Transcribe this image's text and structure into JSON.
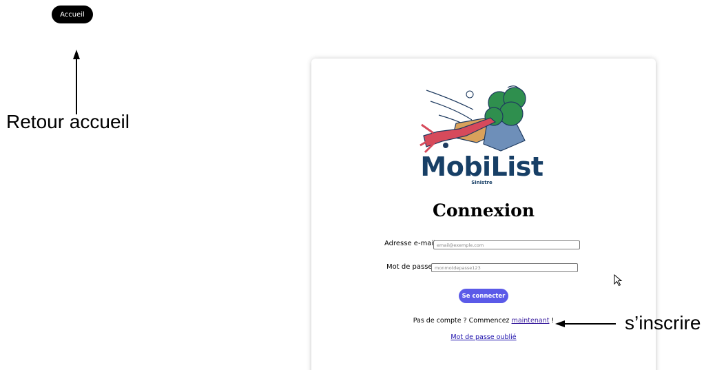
{
  "nav": {
    "home_label": "Accueil"
  },
  "annotations": {
    "home_note": "Retour accueil",
    "signup_note": "s’inscrire"
  },
  "logo": {
    "name": "MobiList",
    "subtitle": "Sinistre"
  },
  "form": {
    "title": "Connexion",
    "email_label": "Adresse e-mail",
    "email_placeholder": "email@exemple.com",
    "password_label": "Mot de passe",
    "password_placeholder": "monmotdepasse123",
    "submit_label": "Se connecter"
  },
  "signup": {
    "prefix": "Pas de compte ? Commencez ",
    "link": "maintenant",
    "suffix": " !"
  },
  "forgot": {
    "label": "Mot de passe oublié"
  },
  "colors": {
    "button": "#5b5ae8",
    "logo_text": "#173f66",
    "tree": "#2f8f4e",
    "trunk": "#d64a5b",
    "debris": "#6e8fb9"
  }
}
